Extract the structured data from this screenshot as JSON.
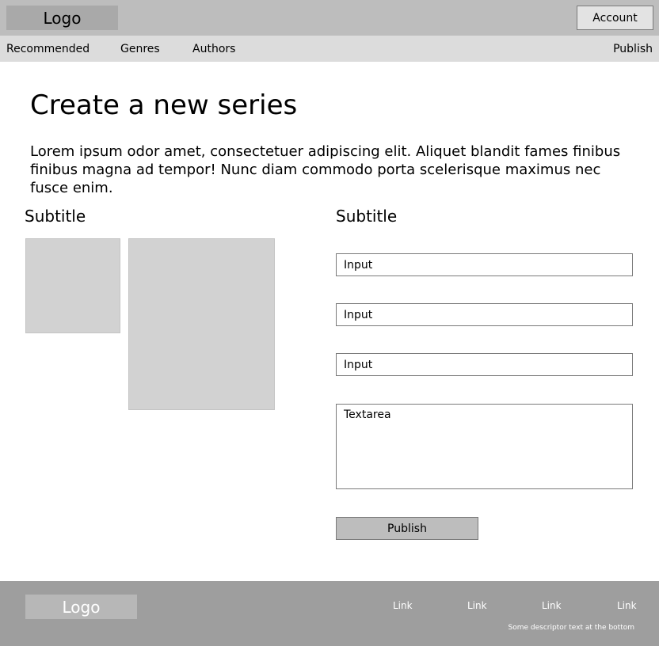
{
  "header": {
    "logo": "Logo",
    "account_label": "Account"
  },
  "nav": {
    "items": [
      "Recommended",
      "Genres",
      "Authors"
    ],
    "publish_label": "Publish"
  },
  "main": {
    "title": "Create a new series",
    "intro": "Lorem ipsum odor amet, consectetuer adipiscing elit. Aliquet blandit fames finibus finibus magna ad tempor! Nunc diam commodo porta scelerisque maximus nec fusce enim.",
    "left_subtitle": "Subtitle",
    "right_subtitle": "Subtitle",
    "form": {
      "inputs": [
        "Input",
        "Input",
        "Input"
      ],
      "textarea": "Textarea",
      "submit_label": "Publish"
    }
  },
  "footer": {
    "logo": "Logo",
    "links": [
      "Link",
      "Link",
      "Link",
      "Link"
    ],
    "descriptor": "Some descriptor text at the bottom"
  },
  "colors": {
    "header_bg": "#bdbdbd",
    "nav_bg": "#dcdcdc",
    "placeholder_bg": "#d2d2d2",
    "footer_bg": "#9e9e9e"
  }
}
